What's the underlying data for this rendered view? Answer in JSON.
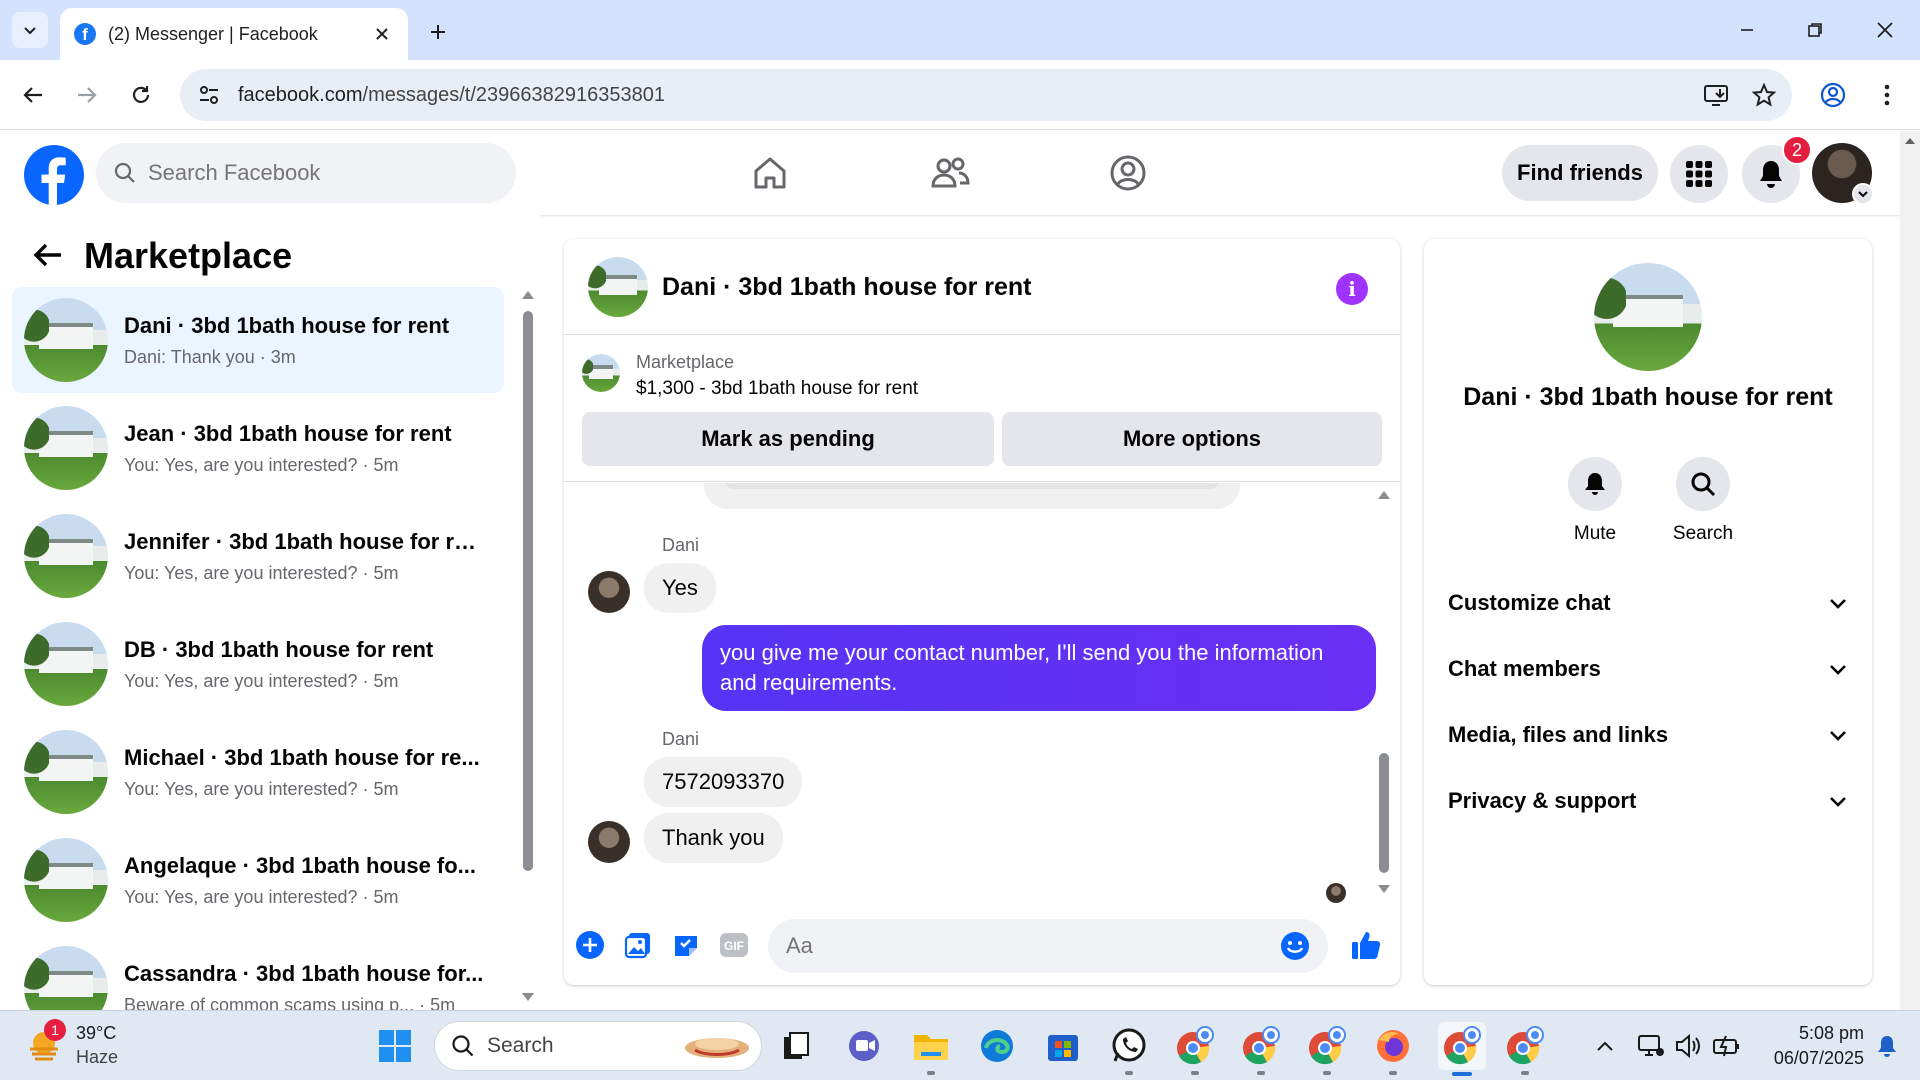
{
  "browser": {
    "tab_title": "(2) Messenger | Facebook",
    "url_host": "facebook.com",
    "url_path": "/messages/t/23966382916353801"
  },
  "header": {
    "search_placeholder": "Search Facebook",
    "find_friends_label": "Find friends",
    "notification_count": "2"
  },
  "sidebar": {
    "title": "Marketplace",
    "conversations": [
      {
        "name": "Dani · 3bd 1bath house for rent",
        "preview": "Dani: Thank you · 3m"
      },
      {
        "name": "Jean · 3bd 1bath house for rent",
        "preview": "You: Yes, are you interested? · 5m"
      },
      {
        "name": "Jennifer · 3bd 1bath house for re...",
        "preview": "You: Yes, are you interested? · 5m"
      },
      {
        "name": "DB · 3bd 1bath house for rent",
        "preview": "You: Yes, are you interested? · 5m"
      },
      {
        "name": "Michael · 3bd 1bath house for re...",
        "preview": "You: Yes, are you interested? · 5m"
      },
      {
        "name": "Angelaque · 3bd 1bath house fo...",
        "preview": "You: Yes, are you interested? · 5m"
      },
      {
        "name": "Cassandra · 3bd 1bath house for...",
        "preview": "Beware of common scams using p... · 5m"
      }
    ]
  },
  "chat": {
    "title": "Dani · 3bd 1bath house for rent",
    "listing_source": "Marketplace",
    "listing_price_title": "$1,300 - 3bd 1bath house for rent",
    "mark_pending_label": "Mark as pending",
    "more_options_label": "More options",
    "messages": [
      {
        "sender": "Dani",
        "text": "Yes"
      },
      {
        "sender": "You",
        "text": "you give me your contact number, I'll send you the information and requirements."
      },
      {
        "sender": "Dani",
        "text": "7572093370"
      },
      {
        "sender": "Dani",
        "text": "Thank you"
      }
    ],
    "input_placeholder": "Aa"
  },
  "details": {
    "name": "Dani · 3bd 1bath house for rent",
    "mute_label": "Mute",
    "search_label": "Search",
    "sections": [
      "Customize chat",
      "Chat members",
      "Media, files and links",
      "Privacy & support"
    ]
  },
  "taskbar": {
    "weather_temp": "39°C",
    "weather_desc": "Haze",
    "weather_badge": "1",
    "search_label": "Search",
    "time": "5:08 pm",
    "date": "06/07/2025"
  },
  "colors": {
    "fb_blue": "#0866ff",
    "messenger_purple": "#5b33f5",
    "badge_red": "#e41e3f"
  }
}
